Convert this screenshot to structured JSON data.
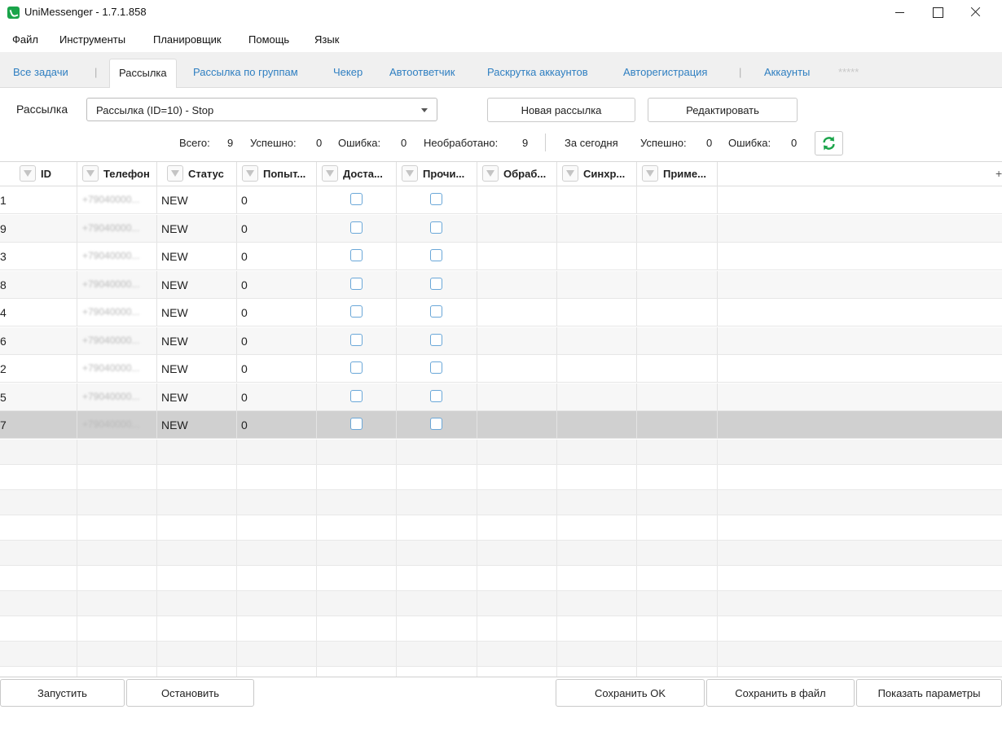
{
  "window": {
    "title": "UniMessenger - 1.7.1.858"
  },
  "menu": [
    "Файл",
    "Инструменты",
    "Планировщик",
    "Помощь",
    "Язык"
  ],
  "tabs": {
    "all_tasks": "Все задачи",
    "sep1": "|",
    "mailing": "Рассылка",
    "group_mailing": "Рассылка по группам",
    "checker": "Чекер",
    "autoresponder": "Автоответчик",
    "promotion": "Раскрутка аккаунтов",
    "autoreg": "Авторегистрация",
    "sep2": "|",
    "accounts": "Аккаунты",
    "masked": "*****"
  },
  "toolbar": {
    "label": "Рассылка",
    "select_value": "Рассылка (ID=10) - Stop",
    "new_button": "Новая рассылка",
    "edit_button": "Редактировать"
  },
  "stats": {
    "total_label": "Всего:",
    "total": "9",
    "success_label": "Успешно:",
    "success": "0",
    "error_label": "Ошибка:",
    "error": "0",
    "unprocessed_label": "Необработано:",
    "unprocessed": "9",
    "today_label": "За сегодня",
    "today_success_label": "Успешно:",
    "today_success": "0",
    "today_error_label": "Ошибка:",
    "today_error": "0"
  },
  "grid": {
    "columns": [
      "ID",
      "Телефон",
      "Статус",
      "Попыт...",
      "Доста...",
      "Прочи...",
      "Обраб...",
      "Синхр...",
      "Приме..."
    ],
    "rows": [
      {
        "id": "1",
        "phone": "+79040000...",
        "status": "NEW",
        "attempts": "0"
      },
      {
        "id": "9",
        "phone": "+79040000...",
        "status": "NEW",
        "attempts": "0"
      },
      {
        "id": "3",
        "phone": "+79040000...",
        "status": "NEW",
        "attempts": "0"
      },
      {
        "id": "8",
        "phone": "+79040000...",
        "status": "NEW",
        "attempts": "0"
      },
      {
        "id": "4",
        "phone": "+79040000...",
        "status": "NEW",
        "attempts": "0"
      },
      {
        "id": "6",
        "phone": "+79040000...",
        "status": "NEW",
        "attempts": "0"
      },
      {
        "id": "2",
        "phone": "+79040000...",
        "status": "NEW",
        "attempts": "0"
      },
      {
        "id": "5",
        "phone": "+79040000...",
        "status": "NEW",
        "attempts": "0"
      },
      {
        "id": "7",
        "phone": "+79040000...",
        "status": "NEW",
        "attempts": "0"
      }
    ],
    "selected_row": 8,
    "add_column": "+"
  },
  "actions": {
    "start": "Запустить",
    "stop": "Остановить",
    "save_ok": "Сохранить OK",
    "save_file": "Сохранить в файл",
    "show_params": "Показать параметры"
  },
  "colors": {
    "accent": "#2f7fc1",
    "refresh": "#1aa44a",
    "checkbox": "#6aa7d8"
  }
}
